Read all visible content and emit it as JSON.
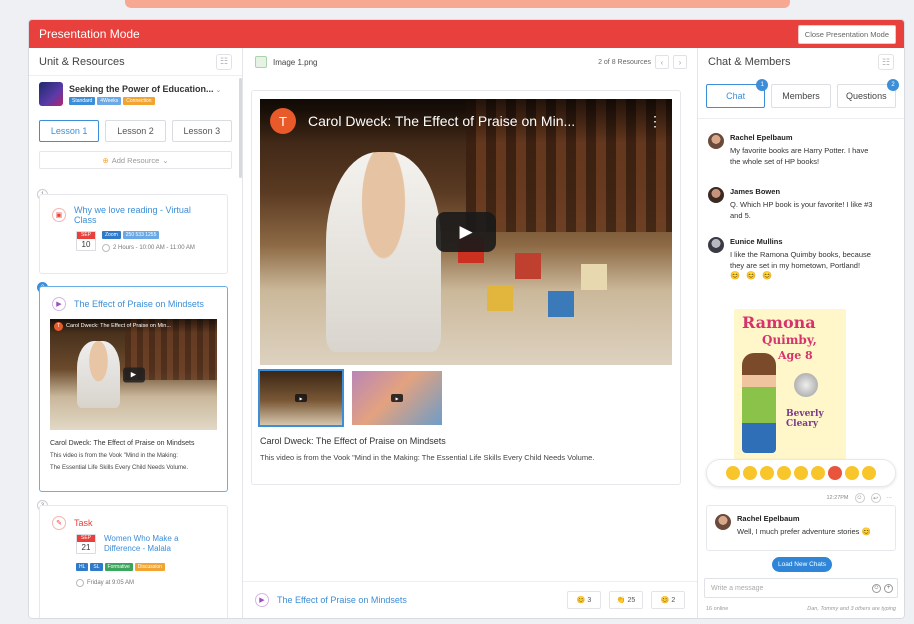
{
  "header": {
    "title": "Presentation Mode",
    "close_label": "Close Presentation Mode"
  },
  "left": {
    "title": "Unit & Resources",
    "unit": {
      "title": "Seeking the Power of Education...",
      "tags": [
        "Standard",
        "4Weeks",
        "Connection"
      ]
    },
    "lessons": [
      "Lesson 1",
      "Lesson 2",
      "Lesson 3"
    ],
    "add_resource": "Add Resource",
    "cards": [
      {
        "num": "1",
        "title": "Why we love reading - Virtual Class",
        "month": "SEP",
        "day": "10",
        "zoom": "Zoom",
        "zoom_id": "250 533 1255",
        "time": "2 Hours - 10:00 AM - 11:00 AM"
      },
      {
        "num": "2",
        "title": "The Effect of Praise on Mindsets",
        "video_title": "Carol Dweck: The Effect of Praise on Min...",
        "caption": "Carol Dweck: The Effect of Praise on Mindsets",
        "desc1": "This video is from the Vook \"Mind in the Making:",
        "desc2": "The Essential Life Skills Every Child Needs Volume."
      },
      {
        "num": "3",
        "type": "Task",
        "title1": "Women Who Make a",
        "title2": "Difference - Malala",
        "month": "SEP",
        "day": "21",
        "tags": [
          "HL",
          "SL",
          "Formative",
          "Discussion"
        ],
        "time": "Friday at 9:05 AM"
      }
    ]
  },
  "middle": {
    "file": "Image 1.png",
    "pager": "2 of 8 Resources",
    "video_badge": "T",
    "video_title": "Carol Dweck: The Effect of Praise on Min...",
    "caption": "Carol Dweck: The Effect of Praise on Mindsets",
    "desc": "This video is from the Vook \"Mind in the Making: The Essential Life Skills Every Child Needs Volume.",
    "footer_title": "The Effect of Praise on Mindsets",
    "reactions": [
      {
        "emoji": "😊",
        "count": "3"
      },
      {
        "emoji": "👏",
        "count": "25"
      },
      {
        "emoji": "😊",
        "count": "2"
      }
    ]
  },
  "right": {
    "title": "Chat & Members",
    "tabs": [
      {
        "label": "Chat",
        "badge": "1"
      },
      {
        "label": "Members"
      },
      {
        "label": "Questions",
        "badge": "2"
      }
    ],
    "messages": [
      {
        "name": "Rachel Epelbaum",
        "text": "My favorite books are Harry Potter.  I have the whole set of HP books!"
      },
      {
        "name": "James Bowen",
        "text": "Q. Which HP book is your favorite! I like #3 and 5."
      },
      {
        "name": "Eunice Mullins",
        "text": "I like the Ramona Quimby books, because they are set in my hometown, Portland!",
        "emoji": "😊 😊 😊"
      }
    ],
    "book": {
      "line1": "Ramona",
      "line2": "Quimby,",
      "line3": "Age 8",
      "author1": "Beverly",
      "author2": "Cleary"
    },
    "time": "12:27PM",
    "last": {
      "name": "Rachel Epelbaum",
      "text": "Well, I much prefer adventure stories 😊"
    },
    "load_new": "Load New Chats",
    "placeholder": "Write a message",
    "online": "16 online",
    "typing": "Dan, Tommy and 3 others are typing"
  }
}
